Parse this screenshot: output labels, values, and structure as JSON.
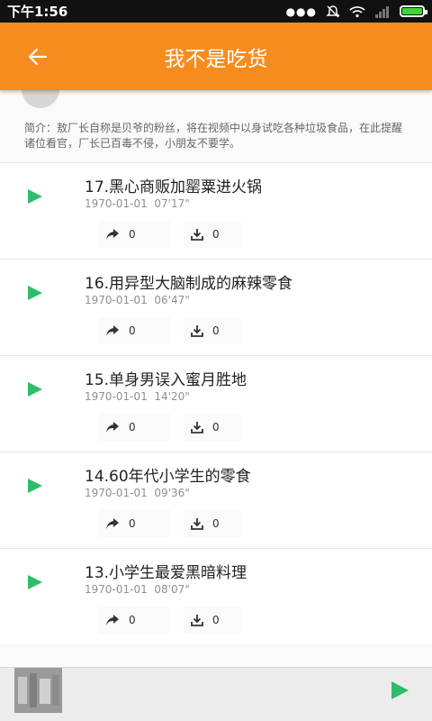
{
  "status_bar": {
    "time": "下午1:56",
    "icons": [
      "more-dots-icon",
      "mute-icon",
      "wifi-icon",
      "signal-icon",
      "battery-icon"
    ],
    "battery_color": "#3fd53a"
  },
  "toolbar": {
    "title": "我不是吃货",
    "back_icon": "arrow-left-icon",
    "color": "#f78c1e"
  },
  "profile": {
    "intro": "简介：敖厂长自称是贝爷的粉丝，将在视频中以身试吃各种垃圾食品，在此提醒诸位看官，厂长已百毒不侵，小朋友不要学。"
  },
  "episodes": [
    {
      "title": "17.黑心商贩加罂粟进火锅",
      "date": "1970-01-01",
      "duration": "07'17\"",
      "shares": "0",
      "downloads": "0"
    },
    {
      "title": "16.用异型大脑制成的麻辣零食",
      "date": "1970-01-01",
      "duration": "06'47\"",
      "shares": "0",
      "downloads": "0"
    },
    {
      "title": "15.单身男误入蜜月胜地",
      "date": "1970-01-01",
      "duration": "14'20\"",
      "shares": "0",
      "downloads": "0"
    },
    {
      "title": "14.60年代小学生的零食",
      "date": "1970-01-01",
      "duration": "09'36\"",
      "shares": "0",
      "downloads": "0"
    },
    {
      "title": "13.小学生最爱黑暗料理",
      "date": "1970-01-01",
      "duration": "08'07\"",
      "shares": "0",
      "downloads": "0"
    }
  ],
  "accent_green": "#2ebd6b"
}
